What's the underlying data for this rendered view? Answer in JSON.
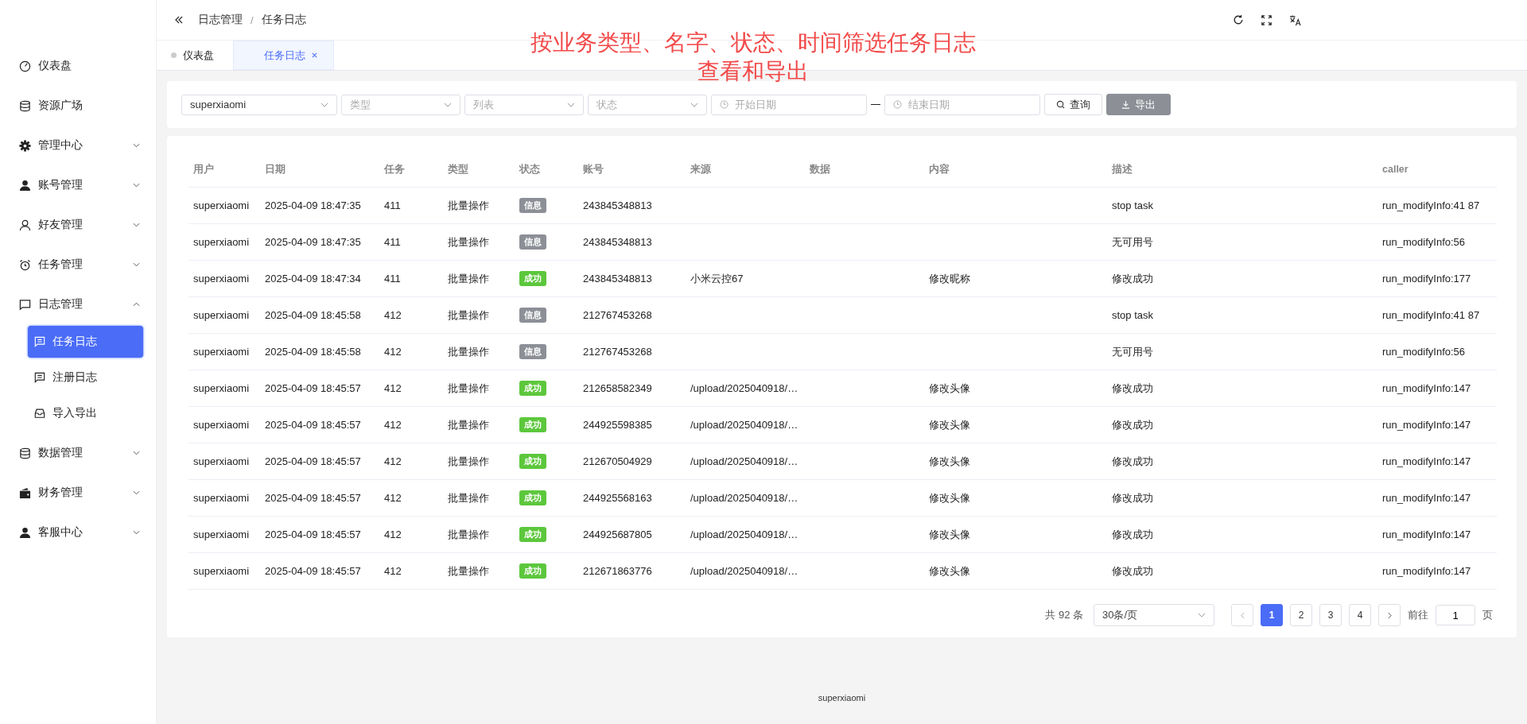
{
  "breadcrumb": [
    "日志管理",
    "任务日志"
  ],
  "breadcrumb_separator": "/",
  "tabs": [
    {
      "label": "仪表盘",
      "selected": false
    },
    {
      "label": "任务日志",
      "selected": true
    }
  ],
  "annotation": [
    "按业务类型、名字、状态、时间筛选任务日志",
    "查看和导出"
  ],
  "sidebar": {
    "items": [
      {
        "label": "仪表盘",
        "selected": false
      },
      {
        "label": "资源广场",
        "selected": false
      },
      {
        "label": "管理中心",
        "selected": false,
        "expanded": false
      },
      {
        "label": "账号管理",
        "selected": false,
        "expanded": false
      },
      {
        "label": "好友管理",
        "selected": false,
        "expanded": false
      },
      {
        "label": "任务管理",
        "selected": false,
        "expanded": false
      },
      {
        "label": "日志管理",
        "selected": false,
        "expanded": true,
        "children": [
          {
            "label": "任务日志",
            "selected": true
          },
          {
            "label": "注册日志",
            "selected": false
          },
          {
            "label": "导入导出",
            "selected": false
          }
        ]
      },
      {
        "label": "数据管理",
        "selected": false,
        "expanded": false
      },
      {
        "label": "财务管理",
        "selected": false,
        "expanded": false
      },
      {
        "label": "客服中心",
        "selected": false,
        "expanded": false
      }
    ]
  },
  "filters": {
    "user": {
      "value": "superxiaomi"
    },
    "type": {
      "placeholder": "类型"
    },
    "list": {
      "placeholder": "列表"
    },
    "status": {
      "placeholder": "状态"
    },
    "start_date": {
      "placeholder": "开始日期"
    },
    "end_date": {
      "placeholder": "结束日期"
    },
    "query_button": "查询",
    "export_button": "导出"
  },
  "table": {
    "columns": [
      "用户",
      "日期",
      "任务",
      "类型",
      "状态",
      "账号",
      "来源",
      "数据",
      "内容",
      "描述",
      "caller"
    ],
    "rows": [
      {
        "user": "superxiaomi",
        "date": "2025-04-09 18:47:35",
        "task": "411",
        "type": "批量操作",
        "status": {
          "label": "信息",
          "kind": "info"
        },
        "account": "243845348813",
        "desc": "stop task",
        "caller": "run_modifyInfo:41 87"
      },
      {
        "user": "superxiaomi",
        "date": "2025-04-09 18:47:35",
        "task": "411",
        "type": "批量操作",
        "status": {
          "label": "信息",
          "kind": "info"
        },
        "account": "243845348813",
        "desc": "无可用号",
        "caller": "run_modifyInfo:56"
      },
      {
        "user": "superxiaomi",
        "date": "2025-04-09 18:47:34",
        "task": "411",
        "type": "批量操作",
        "status": {
          "label": "成功",
          "kind": "success"
        },
        "account": "243845348813",
        "source": "小米云控67",
        "content": "修改昵称",
        "desc": "修改成功",
        "caller": "run_modifyInfo:177"
      },
      {
        "user": "superxiaomi",
        "date": "2025-04-09 18:45:58",
        "task": "412",
        "type": "批量操作",
        "status": {
          "label": "信息",
          "kind": "info"
        },
        "account": "212767453268",
        "desc": "stop task",
        "caller": "run_modifyInfo:41 87"
      },
      {
        "user": "superxiaomi",
        "date": "2025-04-09 18:45:58",
        "task": "412",
        "type": "批量操作",
        "status": {
          "label": "信息",
          "kind": "info"
        },
        "account": "212767453268",
        "desc": "无可用号",
        "caller": "run_modifyInfo:56"
      },
      {
        "user": "superxiaomi",
        "date": "2025-04-09 18:45:57",
        "task": "412",
        "type": "批量操作",
        "status": {
          "label": "成功",
          "kind": "success"
        },
        "account": "212658582349",
        "source": "/upload/2025040918/…",
        "content": "修改头像",
        "desc": "修改成功",
        "caller": "run_modifyInfo:147"
      },
      {
        "user": "superxiaomi",
        "date": "2025-04-09 18:45:57",
        "task": "412",
        "type": "批量操作",
        "status": {
          "label": "成功",
          "kind": "success"
        },
        "account": "244925598385",
        "source": "/upload/2025040918/…",
        "content": "修改头像",
        "desc": "修改成功",
        "caller": "run_modifyInfo:147"
      },
      {
        "user": "superxiaomi",
        "date": "2025-04-09 18:45:57",
        "task": "412",
        "type": "批量操作",
        "status": {
          "label": "成功",
          "kind": "success"
        },
        "account": "212670504929",
        "source": "/upload/2025040918/…",
        "content": "修改头像",
        "desc": "修改成功",
        "caller": "run_modifyInfo:147"
      },
      {
        "user": "superxiaomi",
        "date": "2025-04-09 18:45:57",
        "task": "412",
        "type": "批量操作",
        "status": {
          "label": "成功",
          "kind": "success"
        },
        "account": "244925568163",
        "source": "/upload/2025040918/…",
        "content": "修改头像",
        "desc": "修改成功",
        "caller": "run_modifyInfo:147"
      },
      {
        "user": "superxiaomi",
        "date": "2025-04-09 18:45:57",
        "task": "412",
        "type": "批量操作",
        "status": {
          "label": "成功",
          "kind": "success"
        },
        "account": "244925687805",
        "source": "/upload/2025040918/…",
        "content": "修改头像",
        "desc": "修改成功",
        "caller": "run_modifyInfo:147"
      },
      {
        "user": "superxiaomi",
        "date": "2025-04-09 18:45:57",
        "task": "412",
        "type": "批量操作",
        "status": {
          "label": "成功",
          "kind": "success"
        },
        "account": "212671863776",
        "source": "/upload/2025040918/…",
        "content": "修改头像",
        "desc": "修改成功",
        "caller": "run_modifyInfo:147"
      }
    ]
  },
  "pagination": {
    "total": "共 92 条",
    "page_size": "30条/页",
    "pages": [
      {
        "label": "1",
        "selected": true
      },
      {
        "label": "2",
        "selected": false
      },
      {
        "label": "3",
        "selected": false
      },
      {
        "label": "4",
        "selected": false
      }
    ],
    "goto_label": "前往",
    "goto_value": "1",
    "page_suffix": "页"
  },
  "footer": "superxiaomi"
}
